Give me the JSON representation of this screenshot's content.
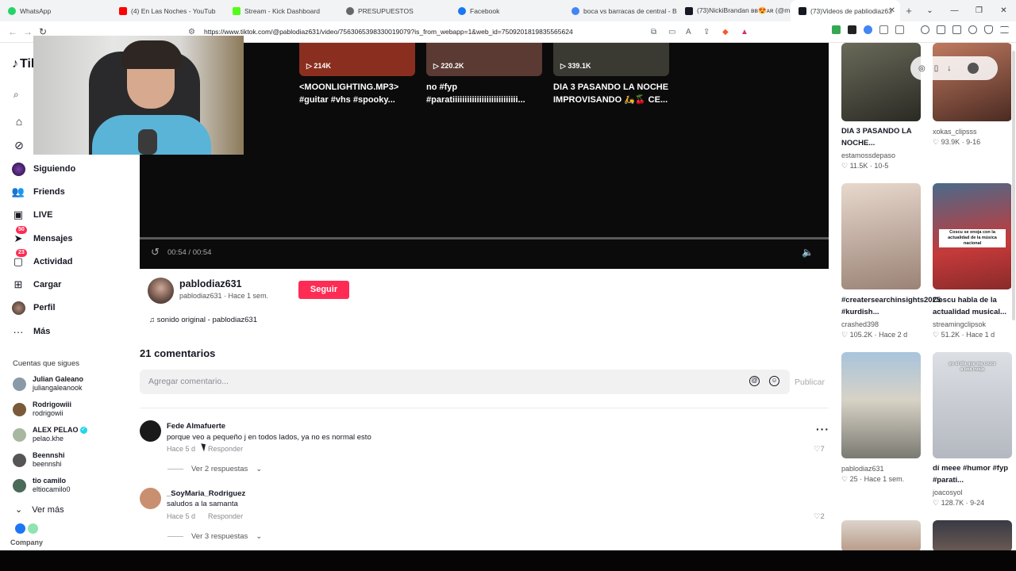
{
  "browser": {
    "tabs": [
      {
        "label": "WhatsApp",
        "color": "#25d366"
      },
      {
        "label": "(4) En Las Noches - YouTub",
        "color": "#ff0000"
      },
      {
        "label": "Stream - Kick Dashboard",
        "color": "#53fc18"
      },
      {
        "label": "PRESUPUESTOS",
        "color": "#666666"
      },
      {
        "label": "Facebook",
        "color": "#1877f2"
      },
      {
        "label": "boca vs barracas de central - B",
        "color": "#4285f4"
      },
      {
        "label": "(73)NickiBrandan вв😍ᴀʀ (@m",
        "color": "#161823"
      },
      {
        "label": "(73)Videos de pabliodiaz63",
        "color": "#161823",
        "active": true
      }
    ],
    "url": "https://www.tiktok.com/@pablodiaz631/video/7563065398330019079?is_from_webapp=1&web_id=7509201819835565624",
    "icons": [
      "back-icon",
      "forward-icon",
      "reload-icon",
      "bookmark-icon",
      "site-settings-icon"
    ]
  },
  "sidebar": {
    "logo": "TikTok",
    "nav": [
      {
        "label": "Siguiendo",
        "icon": "following-avatar-icon"
      },
      {
        "label": "Friends",
        "icon": "friends-icon"
      },
      {
        "label": "LIVE",
        "icon": "live-icon"
      },
      {
        "label": "Mensajes",
        "icon": "messages-icon",
        "badge": "50"
      },
      {
        "label": "Actividad",
        "icon": "activity-icon",
        "badge": "23"
      },
      {
        "label": "Cargar",
        "icon": "upload-icon"
      },
      {
        "label": "Perfil",
        "icon": "profile-avatar-icon"
      },
      {
        "label": "Más",
        "icon": "more-icon"
      }
    ],
    "following_title": "Cuentas que sigues",
    "following": [
      {
        "name": "Julian Galeano",
        "handle": "juliangaleanook",
        "color": "#8a9aa8"
      },
      {
        "name": "Rodrigowiii",
        "handle": "rodrigowii",
        "color": "#7a5a3a"
      },
      {
        "name": "ALEX PELAO",
        "handle": "pelao.khe",
        "color": "#a8b8a0",
        "verified": true
      },
      {
        "name": "Beennshi",
        "handle": "beennshi",
        "color": "#555555"
      },
      {
        "name": "tio camilo",
        "handle": "eltiocamilo0",
        "color": "#4a6a5a"
      }
    ],
    "ver_mas": "Ver más",
    "company": "Company"
  },
  "player": {
    "related": [
      {
        "views": "214K",
        "title": "<MOONLIGHTING.MP3> #guitar #vhs #spooky...",
        "color": "#8a2f1f"
      },
      {
        "views": "220.2K",
        "title": "no #fyp #paratiiiiiiiiiiiiiiiiiiiiiiiiiii...",
        "color": "#5a3a33"
      },
      {
        "views": "339.1K",
        "title": "DIA 3 PASANDO LA NOCHE IMPROVISANDO 🛵🍒 CE...",
        "color": "#3a3a32"
      }
    ],
    "time": "00:54 / 00:54"
  },
  "author": {
    "name": "pablodiaz631",
    "sub": "pablodiaz631 · Hace 1 sem.",
    "follow_label": "Seguir",
    "sound": "♫ sonido original - pablodiaz631"
  },
  "comments": {
    "count_label": "21 comentarios",
    "placeholder": "Agregar comentario...",
    "publish": "Publicar",
    "items": [
      {
        "name": "Fede Almafuerte",
        "text": "porque veo a pequeño j en todos lados, ya no es normal esto",
        "time": "Hace 5 d",
        "reply": "Responder",
        "likes": "7",
        "view_replies": "Ver 2 respuestas",
        "avatar_color": "#1a1a1a"
      },
      {
        "name": "_SoyMaria_Rodriguez",
        "text": "saludos a la samanta",
        "time": "Hace 5 d",
        "reply": "Responder",
        "likes": "2",
        "view_replies": "Ver 3 respuestas",
        "avatar_color": "#c89070"
      }
    ]
  },
  "right": {
    "videos": [
      {
        "title": "DIA 3 PASANDO LA NOCHE...",
        "author": "estamossdepaso",
        "stats": "11.5K · 10-5",
        "color": "#3f3f3a"
      },
      {
        "title": "",
        "author": "xokas_clipsss",
        "stats": "93.9K · 9-16",
        "color": "#9a5a45"
      },
      {
        "title": "#creatersearchinsights2025 #kurdish...",
        "author": "crashed398",
        "stats": "105.2K · Hace 2 d",
        "color": "#c9a89a"
      },
      {
        "title": "Coscu habla de la actualidad musical...",
        "author": "streamingclipsok",
        "stats": "51.2K · Hace 1 d",
        "color": "#c43a3a",
        "overlay": "Coscu se enoja con la actualidad de la música nacional"
      },
      {
        "title": "",
        "author": "pablodiaz631",
        "stats": "25 · Hace 1 sem.",
        "color": "#8aa0b0"
      },
      {
        "title": "dí meee #humor #fyp #parati...",
        "author": "joacosyol",
        "stats": "128.7K · 9-24",
        "color": "#c0c4cc",
        "overlay": "yo el día que me cruce a una oveja"
      }
    ]
  },
  "ext_colors": [
    "#34a853",
    "#222222",
    "#4285f4",
    "#888888",
    "#888888",
    "#5f6368",
    "#5f6368",
    "#5f6368",
    "#5f6368",
    "#5f6368"
  ]
}
